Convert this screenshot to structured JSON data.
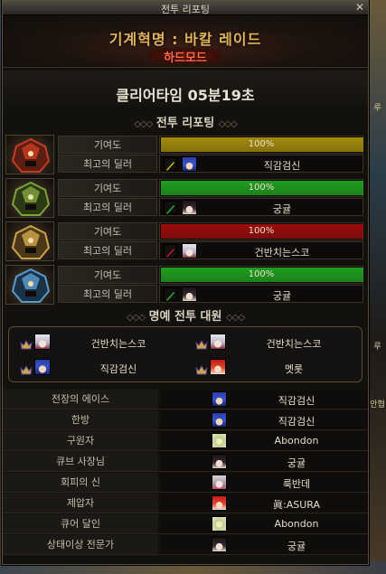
{
  "window": {
    "title": "전투 리포팅",
    "close_symbol": "✕"
  },
  "header": {
    "raid_name": "기계혁명 : 바칼 레이드",
    "mode": "하드모드"
  },
  "clear": {
    "text": "클리어타임   05분19초"
  },
  "section_report": {
    "title": "전투 리포팅",
    "deco": "◇◇◇"
  },
  "report_rows": [
    {
      "boss_icon": "red-mech-boss-icon",
      "contribution_label": "기여도",
      "contribution_percent": 100,
      "contribution_text": "100%",
      "bar_color": "#a38a0e",
      "dealer_label": "최고의 딜러",
      "weapon_color": "#d8c21e",
      "dealer_name": "직감검신",
      "face": "blue-hair-face"
    },
    {
      "boss_icon": "green-mech-boss-icon",
      "contribution_label": "기여도",
      "contribution_percent": 100,
      "contribution_text": "100%",
      "bar_color": "#1f9e1f",
      "dealer_label": "최고의 딜러",
      "weapon_color": "#2cb82c",
      "dealer_name": "궁귤",
      "face": "dark-hair-face"
    },
    {
      "boss_icon": "gold-mech-boss-icon",
      "contribution_label": "기여도",
      "contribution_percent": 100,
      "contribution_text": "100%",
      "bar_color": "#9a0c0c",
      "dealer_label": "최고의 딜러",
      "weapon_color": "#c21c1c",
      "dealer_name": "건반치는스코",
      "face": "white-hair-face"
    },
    {
      "boss_icon": "blue-mech-boss-icon",
      "contribution_label": "기여도",
      "contribution_percent": 100,
      "contribution_text": "100%",
      "bar_color": "#1f9e1f",
      "dealer_label": "최고의 딜러",
      "weapon_color": "#2cb82c",
      "dealer_name": "궁귤",
      "face": "dark-hair-face"
    }
  ],
  "section_honor": {
    "title": "명예 전투 대원",
    "deco": "◇◇◇"
  },
  "honor_members": [
    {
      "name": "건반치는스코",
      "face": "white-hair-face"
    },
    {
      "name": "건반치는스코",
      "face": "white-hair-face"
    },
    {
      "name": "직감검신",
      "face": "blue-hair-face"
    },
    {
      "name": "멧롯",
      "face": "red-hair-face"
    }
  ],
  "titles": [
    {
      "label": "전장의 에이스",
      "name": "직감검신",
      "face": "blue-hair-face"
    },
    {
      "label": "한방",
      "name": "직감검신",
      "face": "blue-hair-face"
    },
    {
      "label": "구원자",
      "name": "Abondon",
      "face": "cream-face"
    },
    {
      "label": "큐브 사장님",
      "name": "궁귤",
      "face": "dark-hair-face"
    },
    {
      "label": "회피의 신",
      "name": "룩반데",
      "face": "pale-face"
    },
    {
      "label": "제압자",
      "name": "眞:ASURA",
      "face": "red-hair-face"
    },
    {
      "label": "큐어 달인",
      "name": "Abondon",
      "face": "cream-face"
    },
    {
      "label": "상태이상 전문가",
      "name": "궁귤",
      "face": "dark-hair-face"
    }
  ],
  "side_text": {
    "top_right": "루",
    "mid_right": "루",
    "lower_right": "안협"
  },
  "colors": {
    "gold_text": "#e0b45e",
    "hard_mode": "#ff6a4a",
    "frame": "#5b4f3a"
  }
}
